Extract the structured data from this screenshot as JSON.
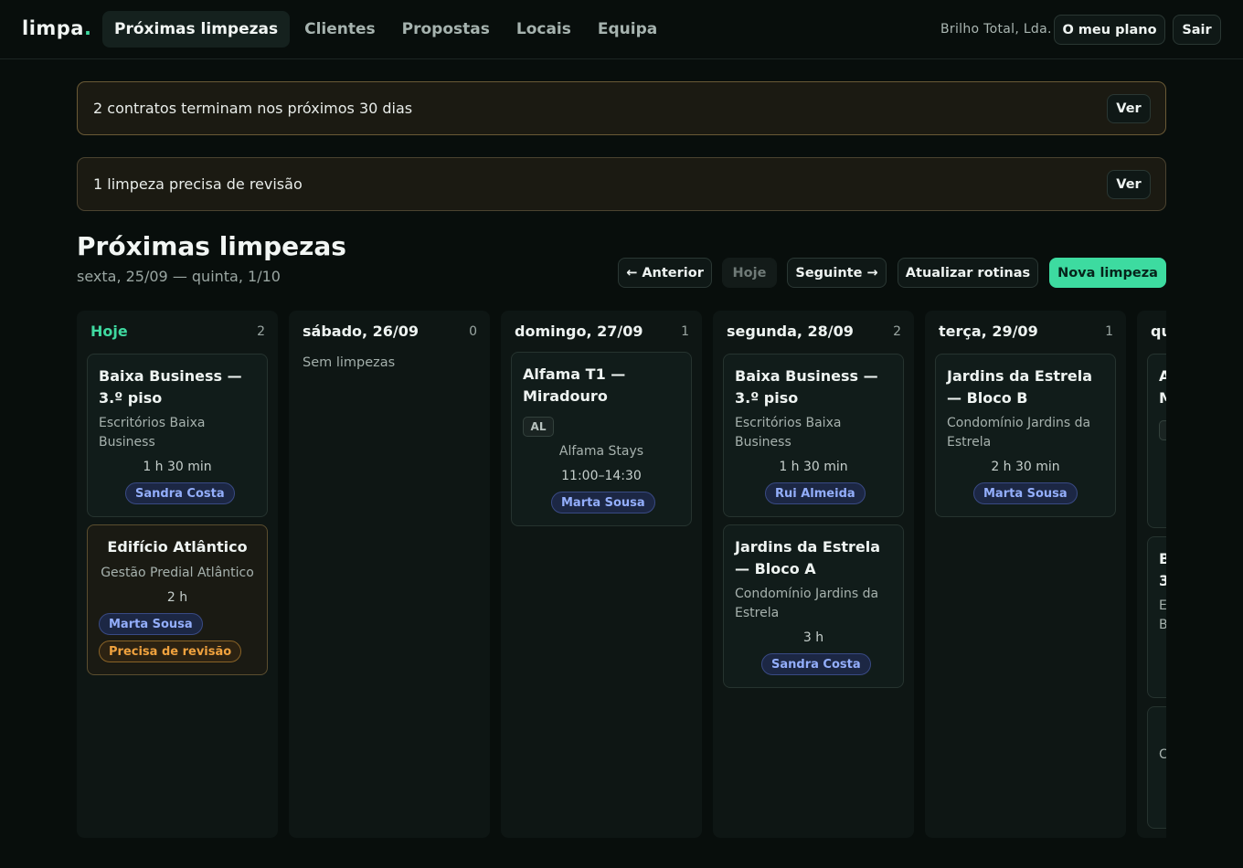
{
  "nav": {
    "logo_text": "limpa",
    "logo_dot": ".",
    "tabs": [
      {
        "label": "Próximas limpezas",
        "active": true
      },
      {
        "label": "Clientes",
        "active": false
      },
      {
        "label": "Propostas",
        "active": false
      },
      {
        "label": "Locais",
        "active": false
      },
      {
        "label": "Equipa",
        "active": false
      }
    ],
    "company": "Brilho Total, Lda.",
    "plan_label": "O meu plano",
    "exit_label": "Sair"
  },
  "alerts": [
    {
      "text": "2 contratos terminam nos próximos 30 dias",
      "button": "Ver"
    },
    {
      "text": "1 limpeza precisa de revisão",
      "button": "Ver"
    }
  ],
  "header": {
    "title": "Próximas limpezas",
    "range": "sexta, 25/09 — quinta, 1/10"
  },
  "toolbar": {
    "prev_label": "← Anterior",
    "today_label": "Hoje",
    "next_label": "Seguinte →",
    "refresh_label": "Atualizar rotinas",
    "new_label": "Nova limpeza"
  },
  "colors": {
    "accent": "#3ddba0",
    "warning": "#f0a23e",
    "chip_text": "#93aefb"
  },
  "columns": [
    {
      "label": "Hoje",
      "count": "2",
      "cards": [
        {
          "title": "Baixa Business — 3.º piso",
          "client": "Escritórios Baixa Business",
          "duration": "1 h 30 min",
          "worker": "Sandra Costa"
        },
        {
          "title": "Edifício Atlântico",
          "client": "Gestão Predial Atlântico",
          "duration": "2 h",
          "worker": "Marta Sousa",
          "flag": "Precisa de revisão"
        }
      ]
    },
    {
      "label": "sábado, 26/09",
      "count": "0",
      "empty": "Sem limpezas",
      "cards": []
    },
    {
      "label": "domingo, 27/09",
      "count": "1",
      "cards": [
        {
          "title": "Alfama T1 — Miradouro",
          "tag": "AL",
          "client": "Alfama Stays",
          "time": "11:00–14:30",
          "worker": "Marta Sousa"
        }
      ]
    },
    {
      "label": "segunda, 28/09",
      "count": "2",
      "cards": [
        {
          "title": "Baixa Business — 3.º piso",
          "client": "Escritórios Baixa Business",
          "duration": "1 h 30 min",
          "worker": "Rui Almeida"
        },
        {
          "title": "Jardins da Estrela — Bloco A",
          "client": "Condomínio Jardins da Estrela",
          "duration": "3 h",
          "worker": "Sandra Costa"
        }
      ]
    },
    {
      "label": "terça, 29/09",
      "count": "1",
      "cards": [
        {
          "title": "Jardins da Estrela — Bloco B",
          "client": "Condomínio Jardins da Estrela",
          "duration": "2 h 30 min",
          "worker": "Marta Sousa"
        }
      ]
    },
    {
      "label": "qu",
      "cards": [
        {
          "title": "A\nM",
          "client": ""
        },
        {
          "title": "B\n3",
          "client": "E\nB"
        },
        {
          "title": "",
          "client": "C"
        }
      ]
    }
  ]
}
